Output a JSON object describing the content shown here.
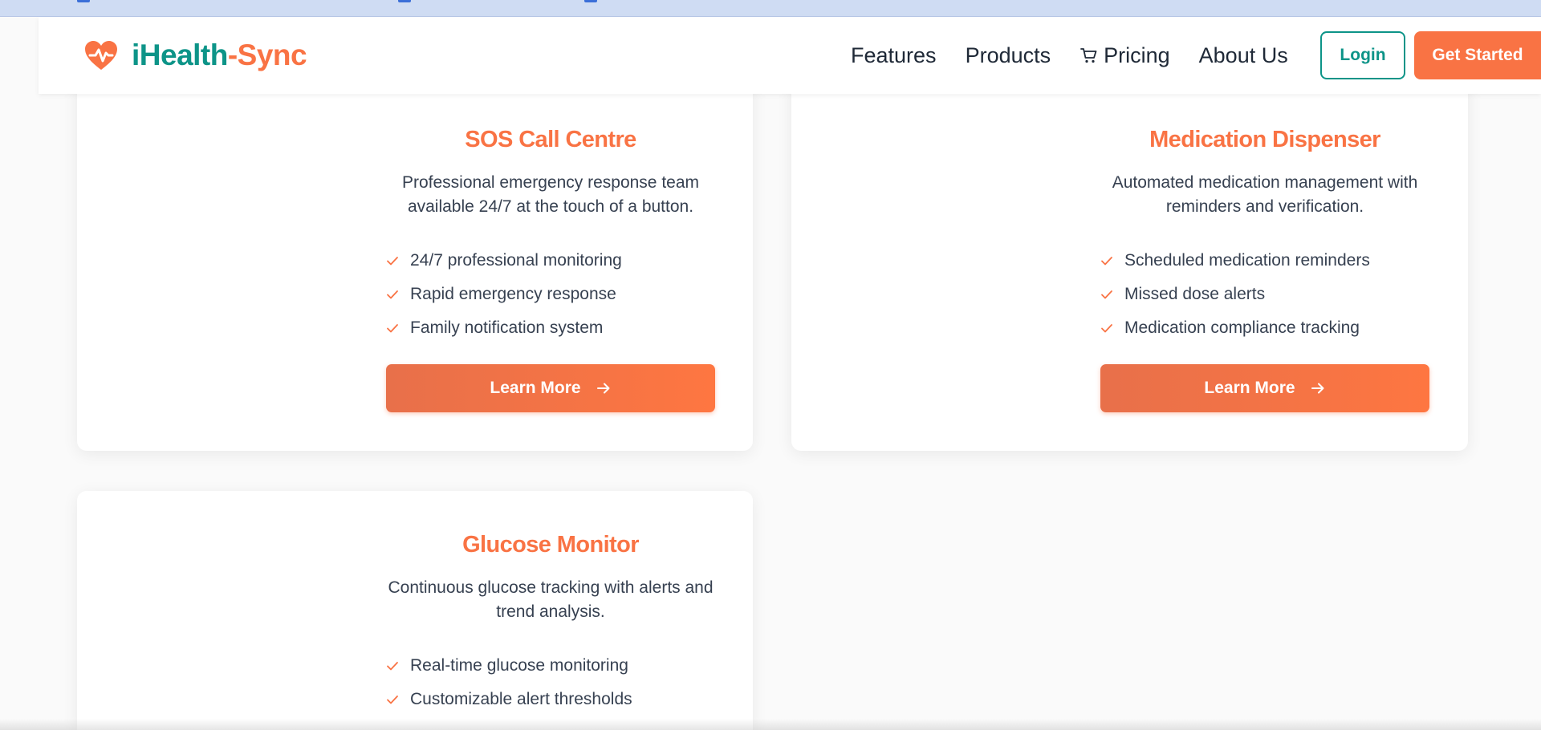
{
  "brand": {
    "name_part1": "iHealth",
    "name_part2": "-Sync",
    "primary_color": "#0d9488",
    "accent_color": "#f97344"
  },
  "nav": {
    "links": [
      {
        "label": "Features"
      },
      {
        "label": "Products"
      },
      {
        "label": "Pricing",
        "icon": "cart-icon"
      },
      {
        "label": "About Us"
      }
    ],
    "login_label": "Login",
    "cta_label": "Get Started"
  },
  "cards": [
    {
      "title": "SOS Call Centre",
      "description": "Professional emergency response team available 24/7 at the touch of a button.",
      "features": [
        "24/7 professional monitoring",
        "Rapid emergency response",
        "Family notification system"
      ],
      "button_label": "Learn More"
    },
    {
      "title": "Medication Dispenser",
      "description": "Automated medication management with reminders and verification.",
      "features": [
        "Scheduled medication reminders",
        "Missed dose alerts",
        "Medication compliance tracking"
      ],
      "button_label": "Learn More"
    },
    {
      "title": "Glucose Monitor",
      "description": "Continuous glucose tracking with alerts and trend analysis.",
      "features": [
        "Real-time glucose monitoring",
        "Customizable alert thresholds"
      ]
    }
  ]
}
